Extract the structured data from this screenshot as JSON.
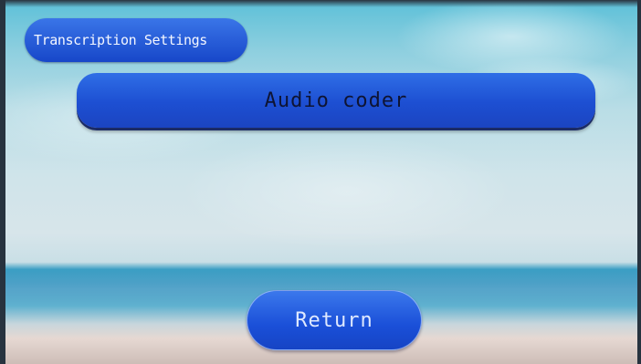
{
  "screen": {
    "title": "Transcription Settings",
    "main_item_label": "Audio coder",
    "return_label": "Return"
  },
  "colors": {
    "button_blue": "#1d4fd2",
    "button_text_light": "#f4f7ff",
    "main_bar_text": "#0e1433"
  }
}
